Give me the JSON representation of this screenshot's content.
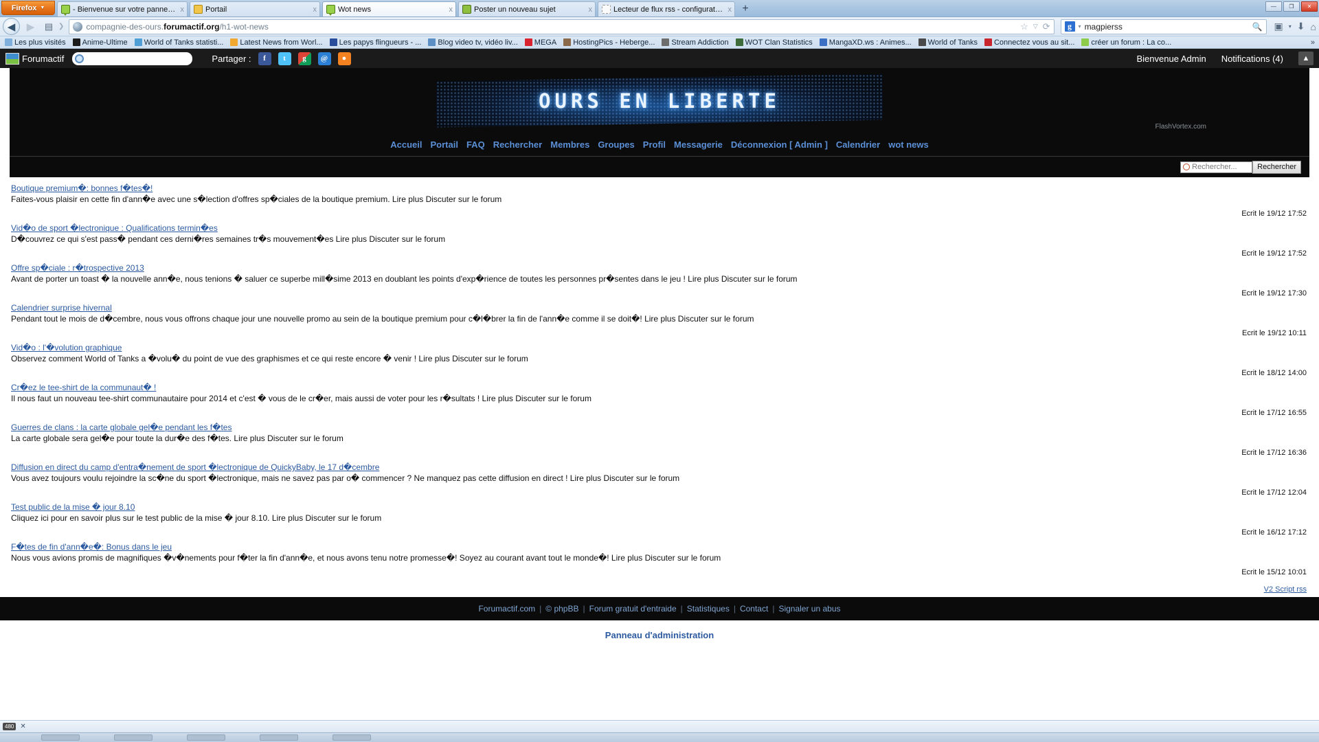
{
  "browser": {
    "app_button": "Firefox",
    "tabs": [
      {
        "title": "- Bienvenue sur votre panneau d'adm...",
        "favicon": "speech-bubble-icon",
        "active": false,
        "closable": true
      },
      {
        "title": "Portail",
        "favicon": "yellow-page-icon",
        "active": false,
        "closable": true
      },
      {
        "title": "Wot news",
        "favicon": "speech-bubble-icon",
        "active": true,
        "closable": true
      },
      {
        "title": "Poster un nouveau sujet",
        "favicon": "post-icon",
        "active": false,
        "closable": true
      },
      {
        "title": "Lecteur de flux rss - configuration",
        "favicon": "blank-page-icon",
        "active": false,
        "closable": true
      }
    ],
    "new_tab_label": "+",
    "window_controls": {
      "minimize": "—",
      "maximize": "❐",
      "close": "✕"
    },
    "url_prefix": "compagnie-des-ours.",
    "url_domain": "forumactif.org",
    "url_path": "/h1-wot-news",
    "search_engine": "g",
    "search_value": "magpierss",
    "bookmarks": [
      {
        "label": "Les plus visités",
        "icon": "most-visited-icon",
        "color": "#7fb0dd"
      },
      {
        "label": "Anime-Ultime",
        "icon": "anime-ultime-icon",
        "color": "#1c1c1c"
      },
      {
        "label": "World of Tanks statisti...",
        "icon": "wot-stats-icon",
        "color": "#4f9fd6"
      },
      {
        "label": "Latest News from Worl...",
        "icon": "rss-feed-icon",
        "color": "#f0a830"
      },
      {
        "label": "Les papys flingueurs - ...",
        "icon": "papys-icon",
        "color": "#2a4d9b"
      },
      {
        "label": "Blog video tv, vidéo liv...",
        "icon": "blog-video-icon",
        "color": "#5c8fc4"
      },
      {
        "label": "MEGA",
        "icon": "mega-icon",
        "color": "#d9232e"
      },
      {
        "label": "HostingPics - Heberge...",
        "icon": "hostingpics-icon",
        "color": "#8a6a4a"
      },
      {
        "label": "Stream Addiction",
        "icon": "stream-addiction-icon",
        "color": "#6d6d6d"
      },
      {
        "label": "WOT Clan Statistics",
        "icon": "wot-clan-icon",
        "color": "#3d6b3a"
      },
      {
        "label": "MangaXD.ws : Animes...",
        "icon": "mangaxd-icon",
        "color": "#3a6fc4"
      },
      {
        "label": "World of Tanks",
        "icon": "world-of-tanks-icon",
        "color": "#4a4a4a"
      },
      {
        "label": "Connectez vous au sit...",
        "icon": "vg-icon",
        "color": "#c8252c"
      },
      {
        "label": "créer un forum : La co...",
        "icon": "speech-bubble-icon",
        "color": "#8ccc4a"
      }
    ],
    "bookmarks_overflow": "»"
  },
  "forumactif_bar": {
    "logo_text": "Forumactif",
    "search_placeholder": "",
    "share_label": "Partager :",
    "social": [
      {
        "name": "facebook-icon",
        "glyph": "f"
      },
      {
        "name": "twitter-icon",
        "glyph": "t"
      },
      {
        "name": "google-plus-icon",
        "glyph": "g"
      },
      {
        "name": "email-icon",
        "glyph": "@"
      },
      {
        "name": "rss-icon",
        "glyph": "●"
      }
    ],
    "welcome": "Bienvenue Admin",
    "notifications": "Notifications (4)",
    "scroll_top_icon": "up-arrow-icon"
  },
  "forum": {
    "banner_text": "OURS EN LIBERTE",
    "banner_credit": "FlashVortex.com",
    "nav_links": [
      "Accueil",
      "Portail",
      "FAQ",
      "Rechercher",
      "Membres",
      "Groupes",
      "Profil",
      "Messagerie",
      "Déconnexion [ Admin ]",
      "Calendrier",
      "wot news"
    ],
    "search_placeholder": "Rechercher...",
    "search_button": "Rechercher",
    "news": [
      {
        "title": "Boutique premium�: bonnes f�tes�!",
        "desc": "Faites-vous plaisir en cette fin d'ann�e avec une s�lection d'offres sp�ciales de la boutique premium. Lire plus Discuter sur le forum",
        "date": "Ecrit le 19/12 17:52"
      },
      {
        "title": "Vid�o de sport �lectronique : Qualifications termin�es",
        "desc": "D�couvrez ce qui s'est pass� pendant ces derni�res semaines tr�s mouvement�es Lire plus Discuter sur le forum",
        "date": "Ecrit le 19/12 17:52"
      },
      {
        "title": "Offre sp�ciale : r�trospective 2013",
        "desc": "Avant de porter un toast � la nouvelle ann�e, nous tenions � saluer ce superbe mill�sime 2013 en doublant les points d'exp�rience de toutes les personnes pr�sentes dans le jeu ! Lire plus Discuter sur le forum",
        "date": "Ecrit le 19/12 17:30"
      },
      {
        "title": "Calendrier surprise hivernal",
        "desc": "Pendant tout le mois de d�cembre, nous vous offrons chaque jour une nouvelle promo au sein de la boutique premium pour c�l�brer la fin de l'ann�e comme il se doit�! Lire plus Discuter sur le forum",
        "date": "Ecrit le 19/12 10:11"
      },
      {
        "title": "Vid�o : l'�volution graphique",
        "desc": "Observez comment World of Tanks a �volu� du point de vue des graphismes et ce qui reste encore � venir ! Lire plus Discuter sur le forum",
        "date": "Ecrit le 18/12 14:00"
      },
      {
        "title": "Cr�ez le tee-shirt de la communaut� !",
        "desc": "Il nous faut un nouveau tee-shirt communautaire pour 2014 et c'est � vous de le cr�er, mais aussi de voter pour les r�sultats ! Lire plus Discuter sur le forum",
        "date": "Ecrit le 17/12 16:55"
      },
      {
        "title": "Guerres de clans : la carte globale gel�e pendant les f�tes",
        "desc": "La carte globale sera gel�e pour toute la dur�e des f�tes. Lire plus Discuter sur le forum",
        "date": "Ecrit le 17/12 16:36"
      },
      {
        "title": "Diffusion en direct du camp d'entra�nement de sport �lectronique de QuickyBaby, le 17 d�cembre",
        "desc": "Vous avez toujours voulu rejoindre la sc�ne du sport �lectronique, mais ne savez pas par o� commencer ? Ne manquez pas cette diffusion en direct ! Lire plus Discuter sur le forum",
        "date": "Ecrit le 17/12 12:04"
      },
      {
        "title": "Test public de la mise � jour 8.10",
        "desc": "Cliquez ici pour en savoir plus sur le test public de la mise � jour 8.10. Lire plus Discuter sur le forum",
        "date": "Ecrit le 16/12 17:12"
      },
      {
        "title": "F�tes de fin d'ann�e�: Bonus dans le jeu",
        "desc": "Nous vous avions promis de magnifiques �v�nements pour f�ter la fin d'ann�e, et nous avons tenu notre promesse�! Soyez au courant avant tout le monde�! Lire plus Discuter sur le forum",
        "date": "Ecrit le 15/12 10:01"
      }
    ],
    "rss_link": "V2 Script rss",
    "footer": [
      "Forumactif.com",
      "© phpBB",
      "Forum gratuit d'entraide",
      "Statistiques",
      "Contact",
      "Signaler un abus"
    ],
    "admin_panel": "Panneau d'administration"
  },
  "statusbar": {
    "zoom_badge": "480",
    "close_label": "✕"
  },
  "colors": {
    "link": "#2c5aa0",
    "nav_link": "#5b8fd6",
    "chrome_blue": "#aac6e2",
    "forum_black": "#0b0b0b"
  }
}
